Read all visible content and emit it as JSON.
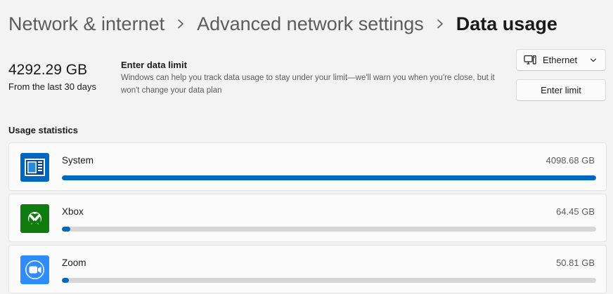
{
  "breadcrumb": [
    {
      "label": "Network & internet"
    },
    {
      "label": "Advanced network settings"
    },
    {
      "label": "Data usage"
    }
  ],
  "summary": {
    "total": "4292.29 GB",
    "period": "From the last 30 days"
  },
  "limit": {
    "title": "Enter data limit",
    "description": "Windows can help you track data usage to stay under your limit—we'll warn you when you're close, but it won't change your data plan",
    "button_label": "Enter limit"
  },
  "adapter_select": {
    "selected": "Ethernet",
    "icon": "desktop-pc-icon"
  },
  "usage": {
    "title": "Usage statistics",
    "items": [
      {
        "name": "System",
        "amount": "4098.68 GB",
        "fraction": 1.0,
        "icon": "windows-system-icon",
        "icon_bg": "#0067c0"
      },
      {
        "name": "Xbox",
        "amount": "64.45 GB",
        "fraction": 0.0157,
        "icon": "xbox-icon",
        "icon_bg": "#107c10"
      },
      {
        "name": "Zoom",
        "amount": "50.81 GB",
        "fraction": 0.0124,
        "icon": "zoom-icon",
        "icon_bg": "#2d8cff"
      }
    ]
  },
  "colors": {
    "accent": "#0067c0",
    "track": "#d6d6d6",
    "background": "#f3f3f3",
    "card": "#fbfbfb"
  }
}
